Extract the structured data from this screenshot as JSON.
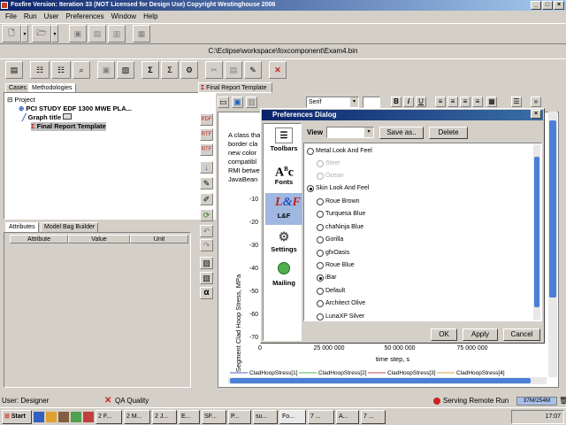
{
  "window": {
    "title": "Foxfire Version: Iteration 33 (NOT Licensed for Design Use)   Copyright Westinghouse 2006"
  },
  "menu": [
    "File",
    "Run",
    "User",
    "Preferences",
    "Window",
    "Help"
  ],
  "path": "C:\\Eclipse\\workspace\\foxcomponent\\Exam4.bin",
  "left_tabs": [
    "Cases",
    "Methodologies"
  ],
  "tree": {
    "root": "Project",
    "items": [
      "PCI STUDY EDF 1300 MWE PLA...",
      "Graph title",
      "Final Report Template"
    ]
  },
  "bottom_tabs": [
    "Attributes",
    "Model Bag Builder"
  ],
  "attributes": {
    "headers": [
      "Attribute",
      "Value",
      "Unit"
    ]
  },
  "editor": {
    "tab": "Final Report Template",
    "font": "Serif",
    "side_buttons": [
      "PDF",
      "RTF",
      "RTF"
    ],
    "text_lines": [
      "A class tha",
      "border cla",
      "new color",
      "compatibl",
      "RMI betwe",
      "JavaBean"
    ]
  },
  "chart_data": {
    "type": "line",
    "ylabel": "Segment Clad Hoop Stress, MPa",
    "xlabel": "time step, s",
    "y_ticks": [
      "-10",
      "-20",
      "-30",
      "-40",
      "-50",
      "-60",
      "-70"
    ],
    "x_ticks": [
      "0",
      "25 000 000",
      "50 000 000",
      "75 000 000"
    ],
    "legend": [
      "CladHoopStress[1]",
      "CladHoopStress[2]",
      "CladHoopStress[3]",
      "CladHoopStress[4]"
    ],
    "series_colors": [
      "#5060c0",
      "#50b050",
      "#c05050",
      "#d0a040"
    ]
  },
  "dialog": {
    "title": "Preferences Dialog",
    "view_label": "View",
    "save_as": "Save as..",
    "delete": "Delete",
    "categories": [
      "Toolbars",
      "Fonts",
      "L&F",
      "Settings",
      "Mailing"
    ],
    "lf_groups": [
      {
        "label": "Metal Look And Feel",
        "options": [
          "Steel",
          "Ocean"
        ]
      },
      {
        "label": "Skin Look And Feel",
        "options": [
          "Roue Brown",
          "Turquesa Blue",
          "chaNinja Blue",
          "Gorilla",
          "gfxOasis",
          "Roue Blue",
          "iBar",
          "Default",
          "Architect Olive",
          "LunaXP Silver"
        ]
      }
    ],
    "selected_skin": "iBar",
    "ok": "OK",
    "apply": "Apply",
    "cancel": "Cancel"
  },
  "status": {
    "user": "User: Designer",
    "qa": "QA Quality",
    "serving": "Serving Remote Run",
    "memory": "37M/254M"
  },
  "taskbar": {
    "start": "Start",
    "tasks": [
      "2 F...",
      "2 M...",
      "2 J...",
      "E...",
      "SF...",
      "P...",
      "su...",
      "Fo...",
      "7 ...",
      "A...",
      "7 ..."
    ],
    "clock": "17:07"
  },
  "colors": {
    "title_start": "#0a246a",
    "title_end": "#a6caf0",
    "selection": "#c0c0c0"
  }
}
